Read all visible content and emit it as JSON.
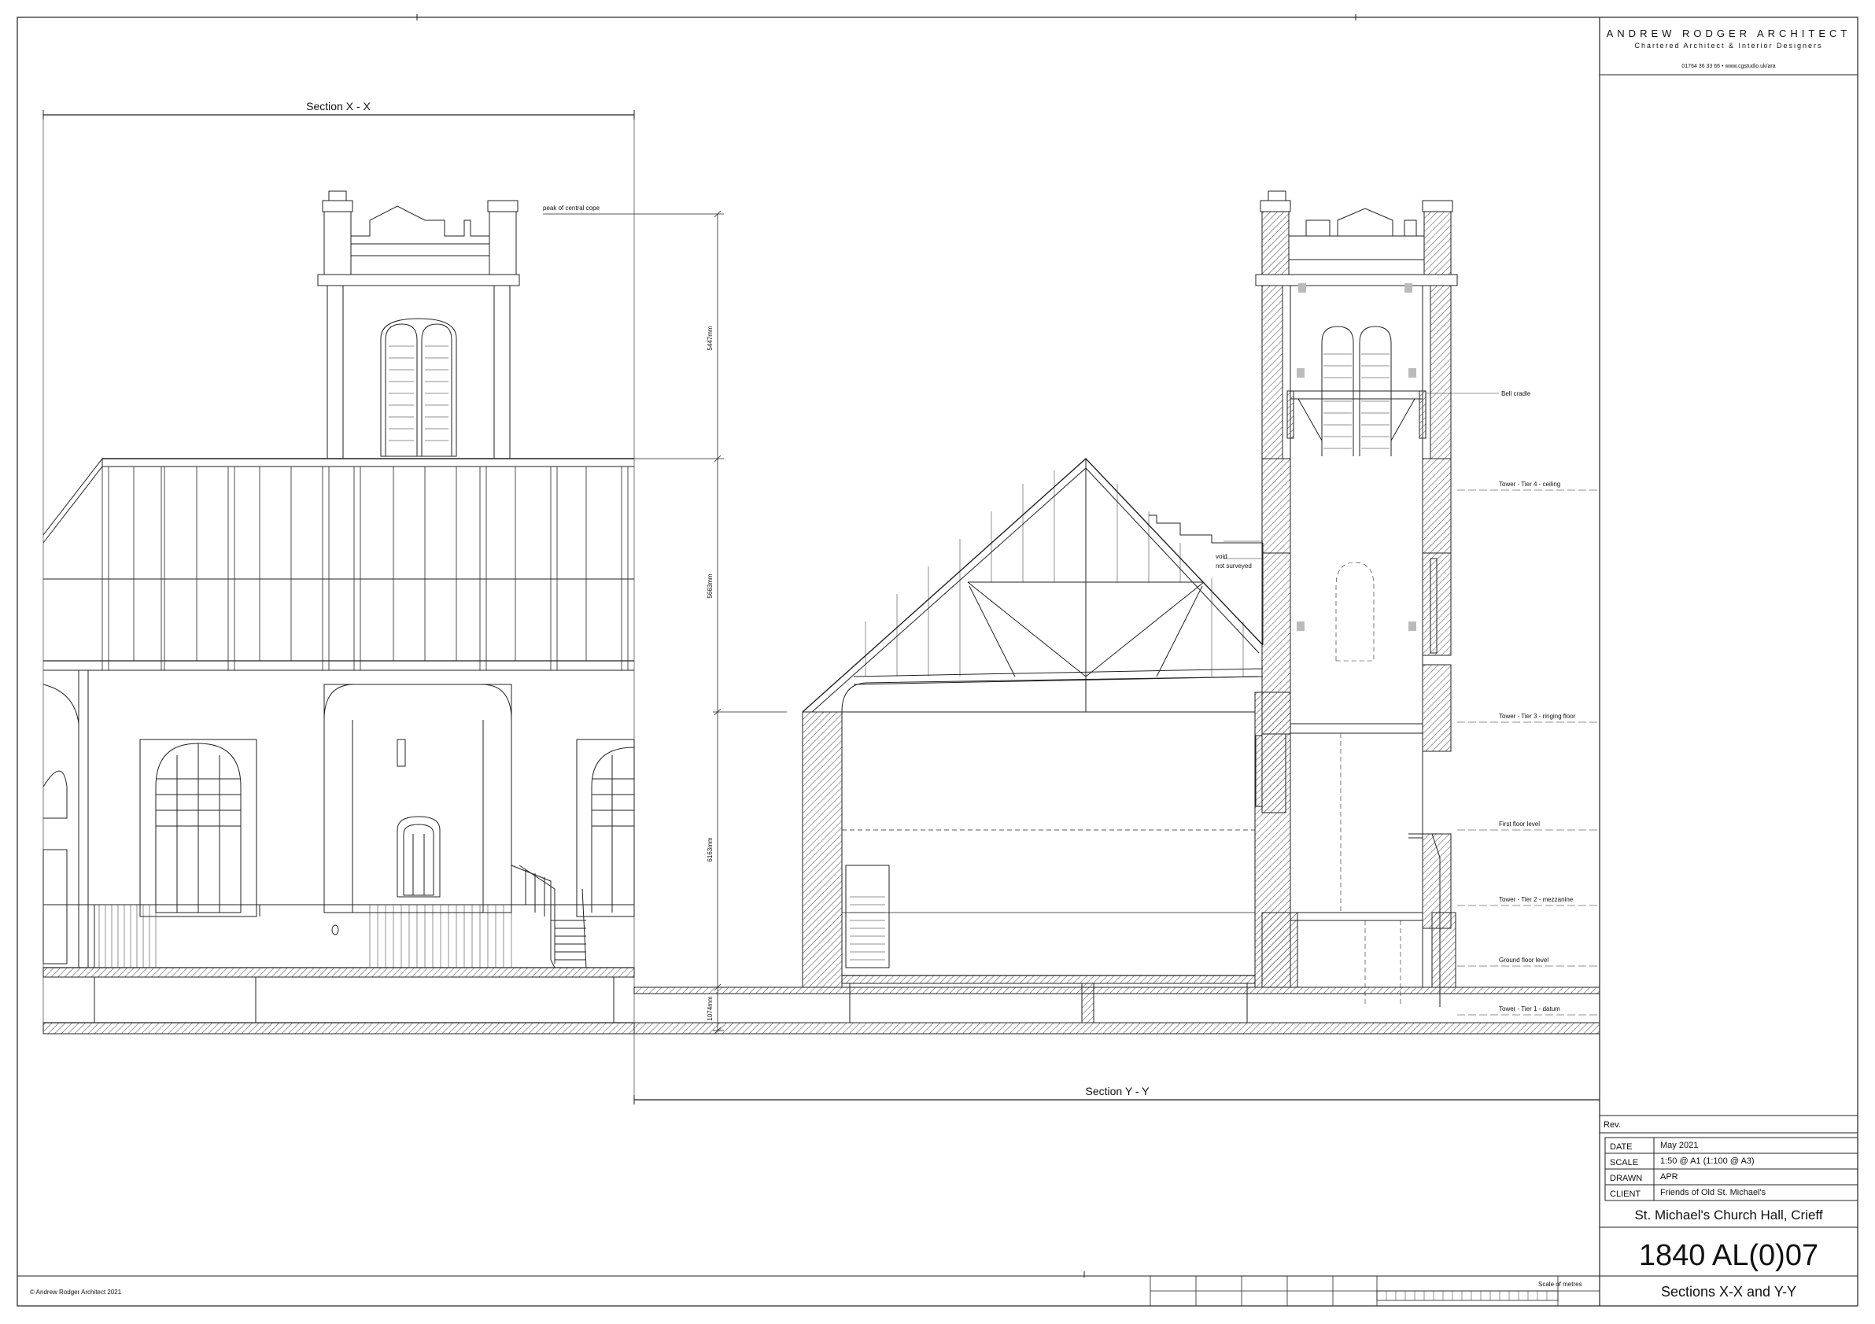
{
  "firm": {
    "name": "ANDREW RODGER ARCHITECT",
    "subtitle": "Chartered Architect & Interior Designers",
    "contact": "01764 36 33 66  •  www.cgstudio.uk/ara"
  },
  "sections": {
    "xx_title": "Section X - X",
    "yy_title": "Section Y - Y"
  },
  "dimensions": {
    "d1": "5447mm",
    "d2": "5663mm",
    "d3": "6163mm",
    "d4": "1074mm"
  },
  "notes": {
    "peak": "peak of central cope",
    "bell": "Bell cradle",
    "void1": "void",
    "void2": "not surveyed"
  },
  "levels": [
    "Tower - Tier 4 - ceiling",
    "Tower - Tier 3 - ringing floor",
    "First floor level",
    "Tower - Tier 2 - mezzanine",
    "Ground floor level",
    "Tower - Tier 1 - datum"
  ],
  "title_block": {
    "rev_label": "Rev.",
    "rows": [
      {
        "label": "DATE",
        "value": "May 2021"
      },
      {
        "label": "SCALE",
        "value": "1:50 @ A1 (1:100 @ A3)"
      },
      {
        "label": "DRAWN",
        "value": "APR"
      },
      {
        "label": "CLIENT",
        "value": "Friends of Old St. Michael's"
      }
    ],
    "project": "St. Michael's Church Hall, Crieff",
    "drawing_number": "1840 AL(0)07",
    "drawing_title": "Sections X-X and Y-Y"
  },
  "scale_bar_label": "Scale of metres",
  "copyright": "© Andrew Rodger Architect 2021"
}
